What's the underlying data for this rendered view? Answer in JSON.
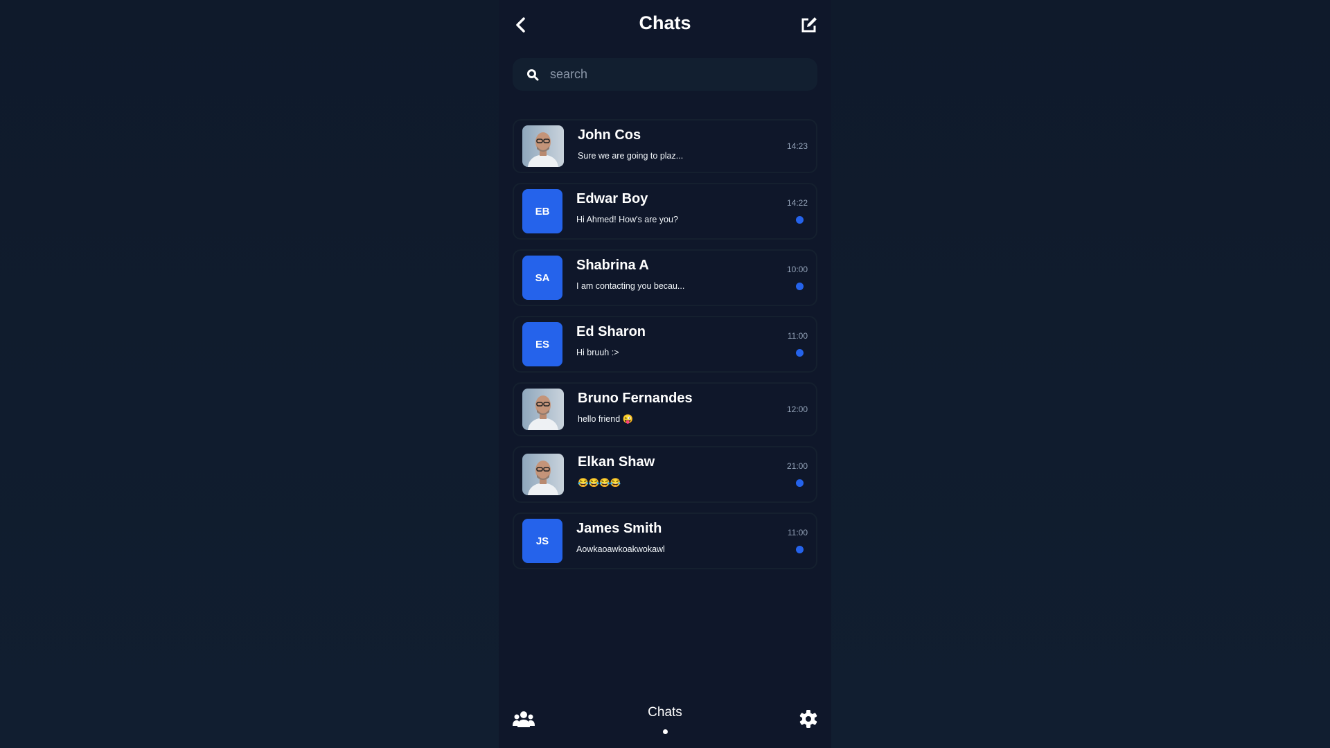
{
  "header": {
    "title": "Chats",
    "back_icon": "chevron-left-icon",
    "compose_icon": "edit-icon"
  },
  "search": {
    "placeholder": "search",
    "value": ""
  },
  "chats": [
    {
      "name": "John Cos",
      "message": "Sure we are going to plaz...",
      "time": "14:23",
      "avatar": "photo",
      "unread": false
    },
    {
      "name": "Edwar Boy",
      "message": "Hi Ahmed! How's are you?",
      "time": "14:22",
      "avatar": "EB",
      "unread": true
    },
    {
      "name": "Shabrina A",
      "message": "I am contacting you becau...",
      "time": "10:00",
      "avatar": "SA",
      "unread": true
    },
    {
      "name": "Ed Sharon",
      "message": "Hi bruuh :>",
      "time": "11:00",
      "avatar": "ES",
      "unread": true
    },
    {
      "name": "Bruno Fernandes",
      "message": "hello friend 😜",
      "time": "12:00",
      "avatar": "photo",
      "unread": false
    },
    {
      "name": "Elkan Shaw",
      "message": "😂😂😂😂",
      "time": "21:00",
      "avatar": "photo",
      "unread": true
    },
    {
      "name": "James Smith",
      "message": "Aowkaoawkoakwokawl",
      "time": "11:00",
      "avatar": "JS",
      "unread": true
    }
  ],
  "bottom_nav": {
    "active_label": "Chats",
    "left_icon": "users-icon",
    "right_icon": "gear-icon"
  },
  "colors": {
    "background": "#0f172a",
    "accent": "#2563eb",
    "search_bg": "#121f30"
  }
}
